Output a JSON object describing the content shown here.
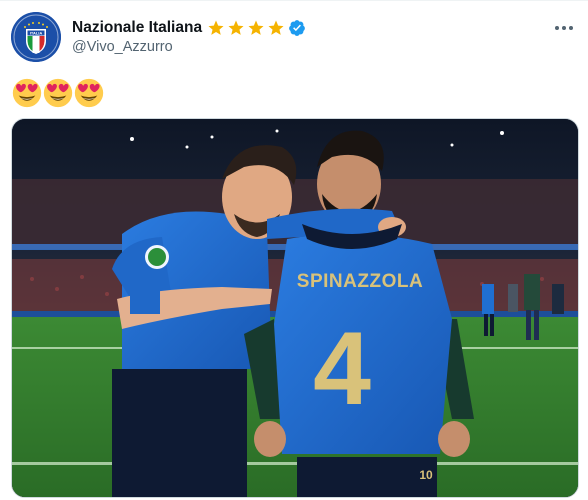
{
  "author": {
    "display_name": "Nazionale Italiana",
    "handle": "@Vivo_Azzurro",
    "star_count": 4,
    "star_color": "#f5b301",
    "verified_color": "#1d9bf0",
    "avatar_icon": "italy-shield-logo",
    "avatar_logo_text": "ITALIA"
  },
  "tweet": {
    "emoji": [
      "heart-eyes",
      "heart-eyes",
      "heart-eyes"
    ],
    "more_icon": "more-horizontal-icon"
  },
  "media": {
    "description_icon": "photo",
    "shirt_name": "SPINAZZOLA",
    "shirt_number": "4",
    "sleeve_number": "10",
    "pitch_color": "#2f7a2c",
    "jersey_color": "#1f6fd1",
    "numerals_color": "#d9c27a"
  },
  "colors": {
    "text_primary": "#0f1419",
    "text_secondary": "#536471",
    "border": "#cfd9de"
  }
}
